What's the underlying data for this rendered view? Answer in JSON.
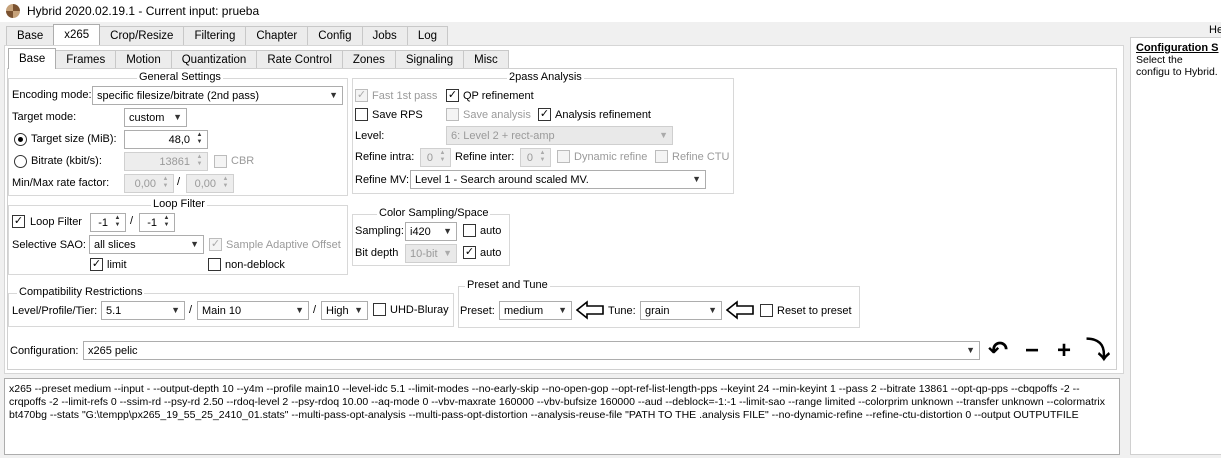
{
  "window": {
    "title": "Hybrid 2020.02.19.1 - Current input: prueba"
  },
  "main_tabs": [
    "Base",
    "x265",
    "Crop/Resize",
    "Filtering",
    "Chapter",
    "Config",
    "Jobs",
    "Log"
  ],
  "main_tab_active": "x265",
  "sub_tabs": [
    "Base",
    "Frames",
    "Motion",
    "Quantization",
    "Rate Control",
    "Zones",
    "Signaling",
    "Misc"
  ],
  "sub_tab_active": "Base",
  "general": {
    "title": "General Settings",
    "encoding_mode_label": "Encoding mode:",
    "encoding_mode_value": "specific filesize/bitrate (2nd pass)",
    "target_mode_label": "Target mode:",
    "target_mode_value": "custom",
    "target_size_label": "Target size (MiB):",
    "target_size_value": "48,0",
    "target_size_selected": true,
    "bitrate_label": "Bitrate (kbit/s):",
    "bitrate_value": "13861",
    "cbr_label": "CBR",
    "minmax_label": "Min/Max rate factor:",
    "min_value": "0,00",
    "max_value": "0,00",
    "slash": "/"
  },
  "twopass": {
    "title": "2pass Analysis",
    "fast_first_label": "Fast 1st pass",
    "fast_first_checked": true,
    "qp_refinement_label": "QP refinement",
    "qp_refinement_checked": true,
    "save_rps_label": "Save RPS",
    "save_rps_checked": false,
    "save_analysis_label": "Save analysis",
    "save_analysis_checked": false,
    "analysis_refinement_label": "Analysis refinement",
    "analysis_refinement_checked": true,
    "level_label": "Level:",
    "level_value": "6: Level 2 + rect-amp",
    "refine_intra_label": "Refine intra:",
    "refine_intra_value": "0",
    "refine_inter_label": "Refine inter:",
    "refine_inter_value": "0",
    "dynamic_refine_label": "Dynamic refine",
    "refine_ctu_label": "Refine CTU",
    "refine_mv_label": "Refine MV:",
    "refine_mv_value": "Level 1 - Search around scaled MV."
  },
  "loop": {
    "title": "Loop Filter",
    "loop_filter_label": "Loop Filter",
    "loop_filter_checked": true,
    "val1": "-1",
    "val2": "-1",
    "slash": "/",
    "selective_sao_label": "Selective SAO:",
    "selective_sao_value": "all slices",
    "sample_adaptive_label": "Sample Adaptive Offset",
    "sample_adaptive_checked": true,
    "limit_label": "limit",
    "limit_checked": true,
    "non_deblock_label": "non-deblock",
    "non_deblock_checked": false
  },
  "color": {
    "title": "Color Sampling/Space",
    "sampling_label": "Sampling:",
    "sampling_value": "i420",
    "auto_label": "auto",
    "auto1_checked": false,
    "bit_depth_label": "Bit depth",
    "bit_depth_value": "10-bit",
    "auto2_checked": true
  },
  "compat": {
    "title": "Compatibility Restrictions",
    "label": "Level/Profile/Tier:",
    "level": "5.1",
    "profile": "Main 10",
    "tier": "High",
    "slash": "/",
    "uhd_label": "UHD-Bluray",
    "uhd_checked": false
  },
  "preset": {
    "title": "Preset and Tune",
    "preset_label": "Preset:",
    "preset_value": "medium",
    "tune_label": "Tune:",
    "tune_value": "grain",
    "reset_label": "Reset to preset",
    "reset_checked": false
  },
  "config": {
    "label": "Configuration:",
    "value": "x265 pelic"
  },
  "command_line": "x265 --preset medium --input - --output-depth 10 --y4m --profile main10 --level-idc 5.1 --limit-modes --no-early-skip --no-open-gop --opt-ref-list-length-pps --keyint 24 --min-keyint 1 --pass 2 --bitrate 13861 --opt-qp-pps --cbqpoffs -2 --crqpoffs -2  --limit-refs 0 --ssim-rd --psy-rd 2.50 --rdoq-level 2 --psy-rdoq 10.00 --aq-mode 0 --vbv-maxrate 160000 --vbv-bufsize 160000 --aud --deblock=-1:-1 --limit-sao --range limited --colorprim unknown --transfer unknown --colormatrix bt470bg --stats \"G:\\tempp\\px265_19_55_25_2410_01.stats\" --multi-pass-opt-analysis --multi-pass-opt-distortion --analysis-reuse-file \"PATH TO THE .analysis FILE\" --no-dynamic-refine --refine-ctu-distortion 0 --output OUTPUTFILE",
  "help": {
    "corner_label": "He",
    "heading": "Configuration S",
    "text": "Select the configu to Hybrid."
  },
  "glyphs": {
    "check": "✓",
    "down": "▼",
    "up": "▲",
    "undo": "↶",
    "minus": "−",
    "plus": "+",
    "redo": "⤵"
  }
}
